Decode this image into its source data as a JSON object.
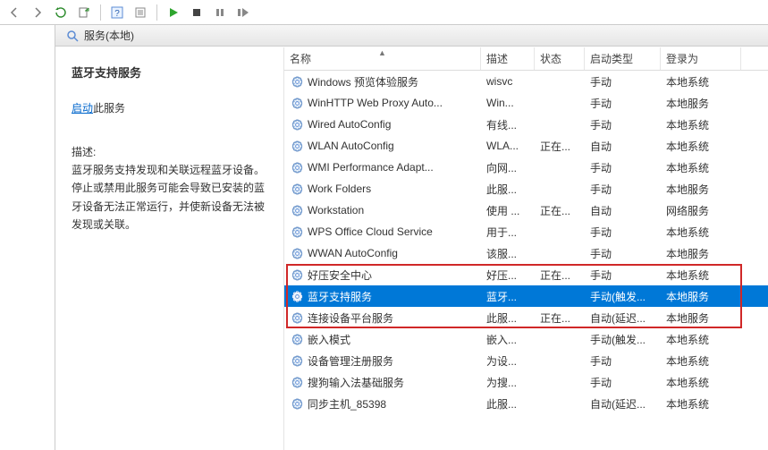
{
  "tab": {
    "label": "服务(本地)"
  },
  "detail": {
    "title": "蓝牙支持服务",
    "start_link": "启动",
    "start_aftertext": "此服务",
    "desc_label": "描述:",
    "description": "蓝牙服务支持发现和关联远程蓝牙设备。停止或禁用此服务可能会导致已安装的蓝牙设备无法正常运行，并使新设备无法被发现或关联。"
  },
  "columns": {
    "name": "名称",
    "desc": "描述",
    "status": "状态",
    "startup": "启动类型",
    "login": "登录为"
  },
  "rows": [
    {
      "name": "Windows 预览体验服务",
      "desc": "wisvc",
      "status": "",
      "startup": "手动",
      "login": "本地系统"
    },
    {
      "name": "WinHTTP Web Proxy Auto...",
      "desc": "Win...",
      "status": "",
      "startup": "手动",
      "login": "本地服务"
    },
    {
      "name": "Wired AutoConfig",
      "desc": "有线...",
      "status": "",
      "startup": "手动",
      "login": "本地系统"
    },
    {
      "name": "WLAN AutoConfig",
      "desc": "WLA...",
      "status": "正在...",
      "startup": "自动",
      "login": "本地系统"
    },
    {
      "name": "WMI Performance Adapt...",
      "desc": "向网...",
      "status": "",
      "startup": "手动",
      "login": "本地系统"
    },
    {
      "name": "Work Folders",
      "desc": "此服...",
      "status": "",
      "startup": "手动",
      "login": "本地服务"
    },
    {
      "name": "Workstation",
      "desc": "使用 ...",
      "status": "正在...",
      "startup": "自动",
      "login": "网络服务"
    },
    {
      "name": "WPS Office Cloud Service",
      "desc": "用于...",
      "status": "",
      "startup": "手动",
      "login": "本地系统"
    },
    {
      "name": "WWAN AutoConfig",
      "desc": "该服...",
      "status": "",
      "startup": "手动",
      "login": "本地服务"
    },
    {
      "name": "好压安全中心",
      "desc": "好压...",
      "status": "正在...",
      "startup": "手动",
      "login": "本地系统"
    },
    {
      "name": "蓝牙支持服务",
      "desc": "蓝牙...",
      "status": "",
      "startup": "手动(触发...",
      "login": "本地服务",
      "selected": true
    },
    {
      "name": "连接设备平台服务",
      "desc": "此服...",
      "status": "正在...",
      "startup": "自动(延迟...",
      "login": "本地服务"
    },
    {
      "name": "嵌入模式",
      "desc": "嵌入...",
      "status": "",
      "startup": "手动(触发...",
      "login": "本地系统"
    },
    {
      "name": "设备管理注册服务",
      "desc": "为设...",
      "status": "",
      "startup": "手动",
      "login": "本地系统"
    },
    {
      "name": "搜狗输入法基础服务",
      "desc": "为搜...",
      "status": "",
      "startup": "手动",
      "login": "本地系统"
    },
    {
      "name": "同步主机_85398",
      "desc": "此服...",
      "status": "",
      "startup": "自动(延迟...",
      "login": "本地系统"
    }
  ],
  "highlight": {
    "from_row": 9,
    "to_row": 11
  }
}
